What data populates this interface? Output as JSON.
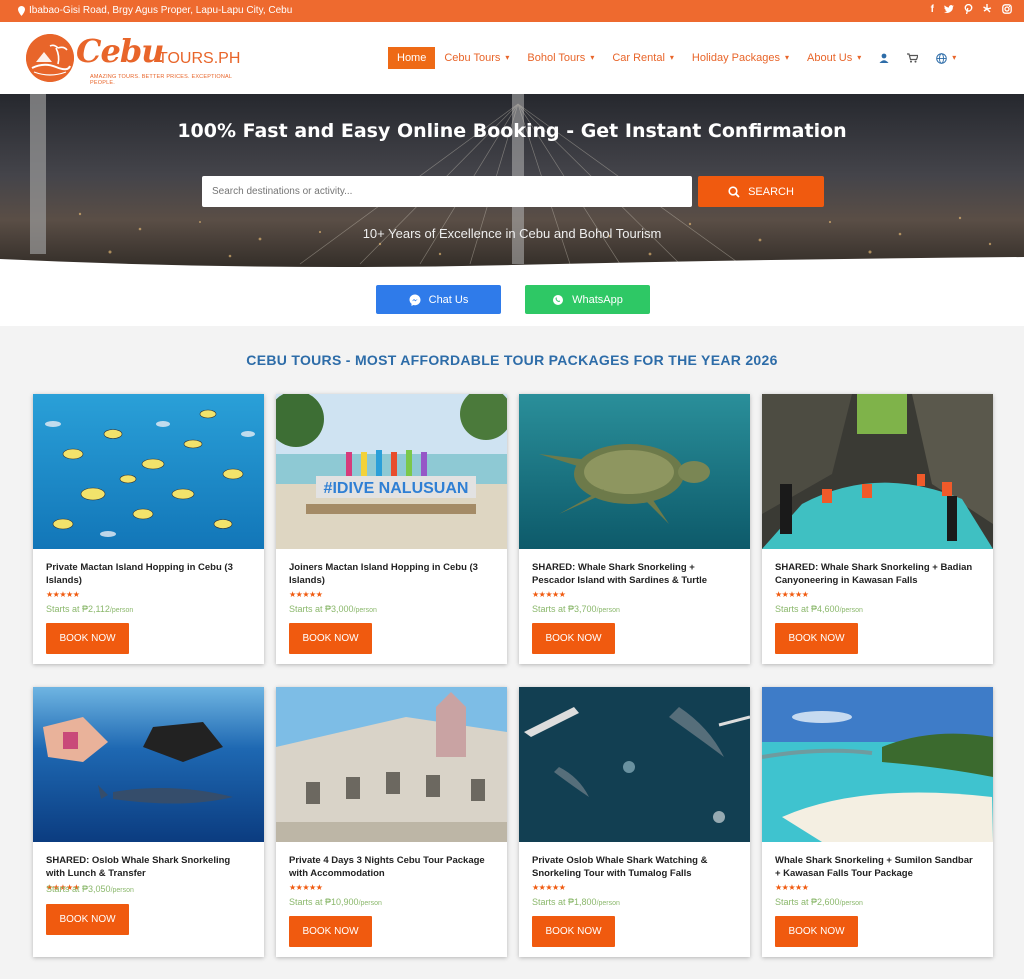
{
  "topbar": {
    "address": "Ibabao-Gisi Road, Brgy Agus Proper, Lapu-Lapu City, Cebu",
    "socials": [
      "f",
      "t",
      "p",
      "y",
      "ig"
    ],
    "color": "#ee6a2f"
  },
  "logo": {
    "brand_main": "Cebu",
    "brand_suffix": "TOURS.PH",
    "tagline": "AMAZING TOURS. BETTER PRICES. EXCEPTIONAL PEOPLE."
  },
  "nav": {
    "items": [
      {
        "label": "Home",
        "active": true
      },
      {
        "label": "Cebu Tours",
        "active": false
      },
      {
        "label": "Bohol Tours",
        "active": false
      },
      {
        "label": "Car Rental",
        "active": false
      },
      {
        "label": "Holiday Packages",
        "active": false
      },
      {
        "label": "About Us",
        "active": false
      }
    ],
    "icons": [
      "user-icon",
      "cart-icon",
      "globe-icon"
    ]
  },
  "hero": {
    "heading": "100% Fast and Easy Online Booking - Get Instant Confirmation",
    "search_placeholder": "Search destinations or activity...",
    "search_button": "SEARCH",
    "subtitle": "10+ Years of Excellence in Cebu and Bohol Tourism"
  },
  "contact": {
    "chat_label": "Chat Us",
    "whatsapp_label": "WhatsApp"
  },
  "section": {
    "title": "CEBU TOURS - MOST AFFORDABLE TOUR PACKAGES FOR THE YEAR 2026"
  },
  "tours": [
    {
      "title": "Private Mactan Island Hopping in Cebu (3 Islands)",
      "rating": 5,
      "price_prefix": "Starts at",
      "price": "₱2,112",
      "per": "/person",
      "button": "BOOK NOW"
    },
    {
      "title": "Joiners Mactan Island Hopping in Cebu (3 Islands)",
      "rating": 5,
      "price_prefix": "Starts at",
      "price": "₱3,000",
      "per": "/person",
      "button": "BOOK NOW"
    },
    {
      "title": "SHARED: Whale Shark Snorkeling + Pescador Island with Sardines & Turtle",
      "rating": 5,
      "price_prefix": "Starts at",
      "price": "₱3,700",
      "per": "/person",
      "button": "BOOK NOW"
    },
    {
      "title": "SHARED: Whale Shark Snorkeling + Badian Canyoneering in Kawasan Falls",
      "rating": 5,
      "price_prefix": "Starts at",
      "price": "₱4,600",
      "per": "/person",
      "button": "BOOK NOW"
    },
    {
      "title": "SHARED: Oslob Whale Shark Snorkeling with Lunch & Transfer",
      "rating": 5,
      "price_prefix": "Starts at",
      "price": "₱3,050",
      "per": "/person",
      "button": "BOOK NOW"
    },
    {
      "title": "Private 4 Days 3 Nights Cebu Tour Package with Accommodation",
      "rating": 5,
      "price_prefix": "Starts at",
      "price": "₱10,900",
      "per": "/person",
      "button": "BOOK NOW"
    },
    {
      "title": "Private Oslob Whale Shark Watching & Snorkeling Tour with Tumalog Falls",
      "rating": 5,
      "price_prefix": "Starts at",
      "price": "₱1,800",
      "per": "/person",
      "button": "BOOK NOW"
    },
    {
      "title": "Whale Shark Snorkeling + Sumilon Sandbar + Kawasan Falls Tour Package",
      "rating": 5,
      "price_prefix": "Starts at",
      "price": "₱2,600",
      "per": "/person",
      "button": "BOOK NOW"
    }
  ],
  "stars_glyph": "★★★★★",
  "colors": {
    "accent": "#f05a0f",
    "section_title": "#2d6ca8",
    "messenger": "#2f7bea",
    "whatsapp": "#2ec865",
    "price": "#8bb86c"
  }
}
